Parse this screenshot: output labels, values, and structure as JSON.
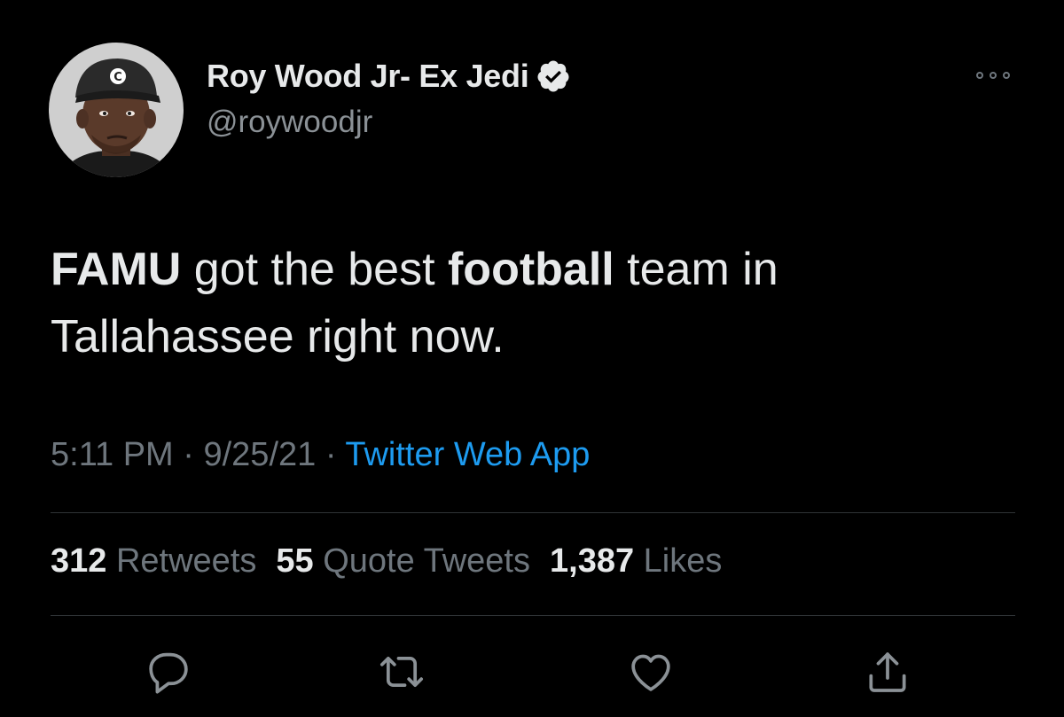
{
  "author": {
    "display_name": "Roy Wood Jr- Ex Jedi",
    "handle": "@roywoodjr",
    "verified": true,
    "avatar_cap_letter": "C"
  },
  "tweet": {
    "segments": [
      {
        "text": "FAMU",
        "bold": true
      },
      {
        "text": " got the best ",
        "bold": false
      },
      {
        "text": "football",
        "bold": true
      },
      {
        "text": " team in Tallahassee right now.",
        "bold": false
      }
    ],
    "time": "5:11 PM",
    "date": "9/25/21",
    "separator": " · ",
    "source": "Twitter Web App"
  },
  "stats": {
    "retweets_count": "312",
    "retweets_label": "Retweets",
    "quotes_count": "55",
    "quotes_label": "Quote Tweets",
    "likes_count": "1,387",
    "likes_label": "Likes"
  },
  "actions": [
    "reply-icon",
    "retweet-icon",
    "like-icon",
    "share-icon"
  ],
  "colors": {
    "background": "#000000",
    "text": "#e7e9ea",
    "secondary": "#6e767d",
    "link": "#1d9bf0",
    "divider": "#2f3336"
  }
}
